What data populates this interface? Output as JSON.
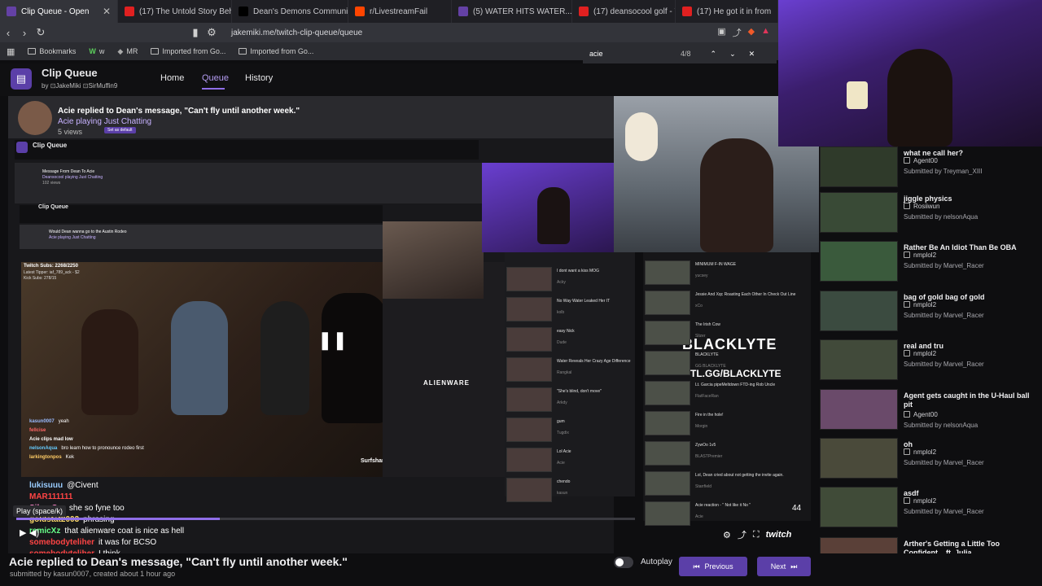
{
  "browser": {
    "tabs": [
      {
        "label": "Clip Queue - Open",
        "icon": "twitch-tab-icon",
        "color": "#6441a5"
      },
      {
        "label": "(17) The Untold Story Behind F",
        "icon": "youtube-tab-icon",
        "color": "#e02020"
      },
      {
        "label": "Dean's Demons Community / X",
        "icon": "x-tab-icon",
        "color": "#000000"
      },
      {
        "label": "r/LivestreamFail",
        "icon": "reddit-tab-icon",
        "color": "#ff4500"
      },
      {
        "label": "(5) WATER HITS WATER...TWITCH",
        "icon": "twitch-tab-icon",
        "color": "#6441a5"
      },
      {
        "label": "(17) deansocool golf - YouTube",
        "icon": "youtube-tab-icon",
        "color": "#e02020"
      },
      {
        "label": "(17) He got it in from",
        "icon": "youtube-tab-icon",
        "color": "#e02020"
      }
    ],
    "url": "jakemiki.me/twitch-clip-queue/queue",
    "bookmarks": [
      "Bookmarks",
      "w",
      "MR",
      "Imported from Go...",
      "Imported from Go..."
    ],
    "find": {
      "query": "acie",
      "count": "4/8"
    }
  },
  "app": {
    "title": "Clip Queue",
    "by": "by",
    "authors": [
      "JakeMiki",
      "SirMuffin9"
    ],
    "nav": [
      "Home",
      "Queue",
      "History"
    ],
    "active_nav": "Queue"
  },
  "current_clip": {
    "title": "Acie replied to Dean's message, \"Can't fly until another week.\"",
    "channel_line": "Acie  playing Just Chatting",
    "views": "5 views",
    "submitted": "submitted by kasun0007, created about 1 hour ago",
    "badge": "Set as default"
  },
  "nested_page": {
    "title": "Clip Queue",
    "clip_line1": "Message From Dean To Acie",
    "clip_line2": "Deansocool playing Just Chatting",
    "clip_views": "102 views",
    "inner_title": "Clip Queue",
    "inner_clip1": "Would Dean wanna go to the Austin Rodeo",
    "inner_clip2": "Acie  playing Just Chatting",
    "subs": "Twitch Subs: 2268/2250",
    "tipper": "Latest Tipper: iaf_789_ack - $2",
    "kick": "Kick Subs: 278/15",
    "overlay_brand1": "BLACKLYTE",
    "overlay_brand2": "TL.GG/BLACKLYTE",
    "overlay_brand3": "ALIENWARE",
    "overlay_brand4": "Surfshark",
    "counter": "44",
    "twitch_logo": "twitch",
    "pause_icon": "pause-icon"
  },
  "nested_list_left": [
    {
      "title": "I dont want a kiss MOG",
      "by": "Acky"
    },
    {
      "title": "No Way Water Leaked Her IT",
      "by": "kolb"
    },
    {
      "title": "easy Nick",
      "by": "Dude"
    },
    {
      "title": "Water Reveals Her Crazy Age Difference",
      "by": "Rangkal"
    },
    {
      "title": "\"She's blind, don't move\"",
      "by": "Arkdy"
    },
    {
      "title": "gum",
      "by": "Tugdix"
    },
    {
      "title": "Lol Acie",
      "by": "Acie"
    },
    {
      "title": "chendo",
      "by": "kasun"
    }
  ],
  "nested_list_right": [
    {
      "title": "MINIMUM F-IN WAGE",
      "by": "yucsey"
    },
    {
      "title": "Jessie And Xqc Roasting Each Other In Check Out Line",
      "by": "xCo"
    },
    {
      "title": "The Irish Cow",
      "by": "Slizer"
    },
    {
      "title": "BLACKLYTE",
      "by": "GG BLACKLYTE"
    },
    {
      "title": "Lt. Garcia pipeMeltdown FTD-ing Rob Uncle",
      "by": "FlatFaceRan"
    },
    {
      "title": "Fire in the hole!",
      "by": "Morgin"
    },
    {
      "title": "ZywOo 1v5",
      "by": "BLASTPremier"
    },
    {
      "title": "Lol, Dean cried about not getting the invite again.",
      "by": "Starrfield"
    },
    {
      "title": "Acie reaction - \" Not like it No \"",
      "by": "Acie"
    }
  ],
  "chat": [
    {
      "user": "kasun0007",
      "msg": "yeah"
    },
    {
      "user": "fellcise",
      "msg": ""
    },
    {
      "user": "Acie clips mad low",
      "msg": ""
    },
    {
      "user": "nelsonAqua",
      "msg": "bro learn how to pronounce rodeo first"
    },
    {
      "user": "larkingtonpos",
      "msg": "Kek"
    },
    {
      "user": "lukisuuu",
      "msg": "@Civent"
    },
    {
      "user": "MAR111111",
      "msg": ""
    },
    {
      "user": "SilverCra",
      "msg": "she so fyne too"
    },
    {
      "user": "goldstat2003",
      "msg": "phrasing"
    },
    {
      "user": "remicXz",
      "msg": "that alienware coat is nice as hell"
    },
    {
      "user": "somebodyteliher",
      "msg": "it was for BCSO"
    },
    {
      "user": "somebodyteliher",
      "msg": "I think"
    }
  ],
  "tooltip": "Play (space/k)",
  "queue": [
    {
      "title": "what ne call her?",
      "channel": "Agent00",
      "submitter": "Submitted by Treyman_XIII",
      "thumb": "#2f3a2a"
    },
    {
      "title": "jiggle physics",
      "channel": "Rosiiwun",
      "submitter": "Submitted by nelsonAqua",
      "thumb": "#394a36"
    },
    {
      "title": "Rather Be An Idiot Than Be OBA",
      "channel": "nmplol2",
      "submitter": "Submitted by Marvel_Racer",
      "thumb": "#3a5a3c"
    },
    {
      "title": "bag of gold bag of gold",
      "channel": "nmplol2",
      "submitter": "Submitted by Marvel_Racer",
      "thumb": "#3b4b40"
    },
    {
      "title": "real and tru",
      "channel": "nmplol2",
      "submitter": "Submitted by Marvel_Racer",
      "thumb": "#414a3a"
    },
    {
      "title": "Agent gets caught in the U-Haul ball pit",
      "channel": "Agent00",
      "submitter": "Submitted by nelsonAqua",
      "thumb": "#6a4a6a"
    },
    {
      "title": "oh",
      "channel": "nmplol2",
      "submitter": "Submitted by Marvel_Racer",
      "thumb": "#4a4a3a"
    },
    {
      "title": "asdf",
      "channel": "nmplol2",
      "submitter": "Submitted by Marvel_Racer",
      "thumb": "#404b38"
    },
    {
      "title": "Arther's Getting a Little Too Confident... ft. Julia",
      "channel": "",
      "submitter": "",
      "thumb": "#5a4038"
    }
  ],
  "controls": {
    "autoplay": "Autoplay",
    "previous": "Previous",
    "next": "Next"
  }
}
